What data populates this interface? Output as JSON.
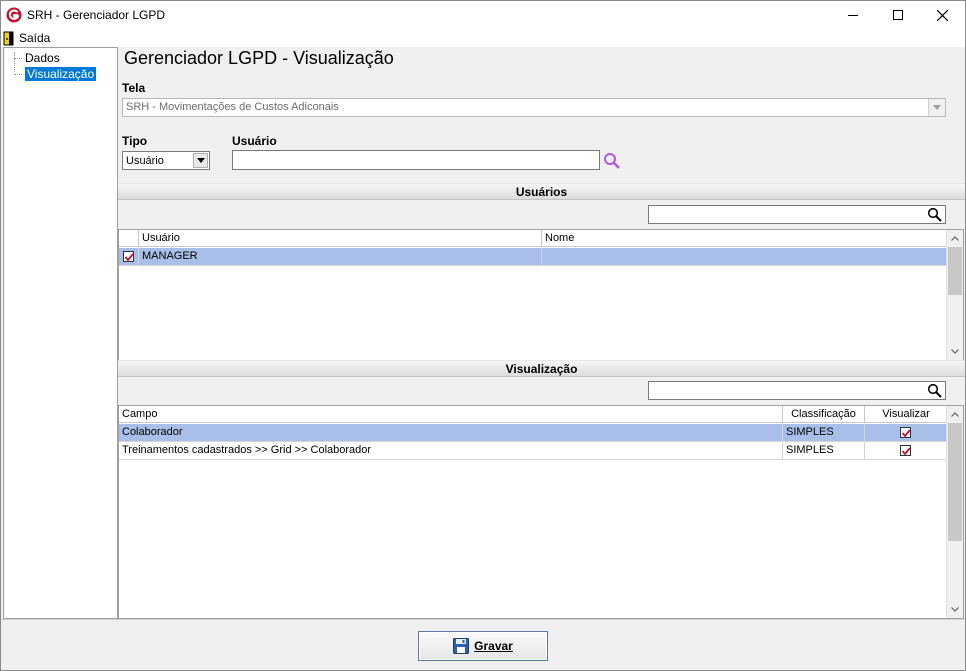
{
  "window": {
    "title": "SRH - Gerenciador LGPD"
  },
  "menu": {
    "saida": "Saída"
  },
  "tree": {
    "items": [
      {
        "label": "Dados"
      },
      {
        "label": "Visualização"
      }
    ]
  },
  "page": {
    "title": "Gerenciador LGPD - Visualização"
  },
  "form": {
    "tela_label": "Tela",
    "tela_value": "SRH - Movimentações de Custos Adiconais",
    "tipo_label": "Tipo",
    "tipo_value": "Usuário",
    "usuario_label": "Usuário",
    "usuario_value": ""
  },
  "usuarios_section": {
    "title": "Usuários",
    "filter_value": "",
    "columns": [
      "Usuário",
      "Nome"
    ],
    "rows": [
      {
        "checked": true,
        "usuario": "MANAGER",
        "nome": ""
      }
    ]
  },
  "visualizacao_section": {
    "title": "Visualização",
    "filter_value": "",
    "columns": [
      "Campo",
      "Classificação",
      "Visualizar"
    ],
    "rows": [
      {
        "campo": "Colaborador",
        "classificacao": "SIMPLES",
        "visualizar": true
      },
      {
        "campo": "Treinamentos cadastrados >> Grid >> Colaborador",
        "classificacao": "SIMPLES",
        "visualizar": true
      }
    ]
  },
  "footer": {
    "save_label": "Gravar"
  },
  "colors": {
    "selection": "#a8bfe9",
    "accent_red": "#c8102e",
    "lookup_purple": "#b05ad9"
  }
}
